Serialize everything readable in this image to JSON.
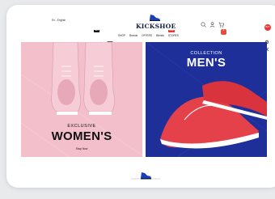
{
  "header": {
    "language": "En - English",
    "logo_text": "KICKSHOE",
    "cart_count": "0"
  },
  "nav": {
    "items": [
      "SHOP",
      "Brands",
      "OFFERS",
      "Blends",
      "STORES"
    ],
    "badge_new": "NEW",
    "badge_sale": "SALE"
  },
  "side_tools": {
    "badge": "BUY"
  },
  "banners": {
    "women": {
      "subtitle": "EXCLUSIVE",
      "title": "WOMEN'S",
      "cta": "Shop Now"
    },
    "men": {
      "subtitle": "COLLECTION",
      "title": "MEN'S"
    }
  },
  "colors": {
    "women_bg": "#f2bfca",
    "men_bg": "#1e2f9a",
    "men_shoe": "#e5414a",
    "accent": "#e53935"
  }
}
